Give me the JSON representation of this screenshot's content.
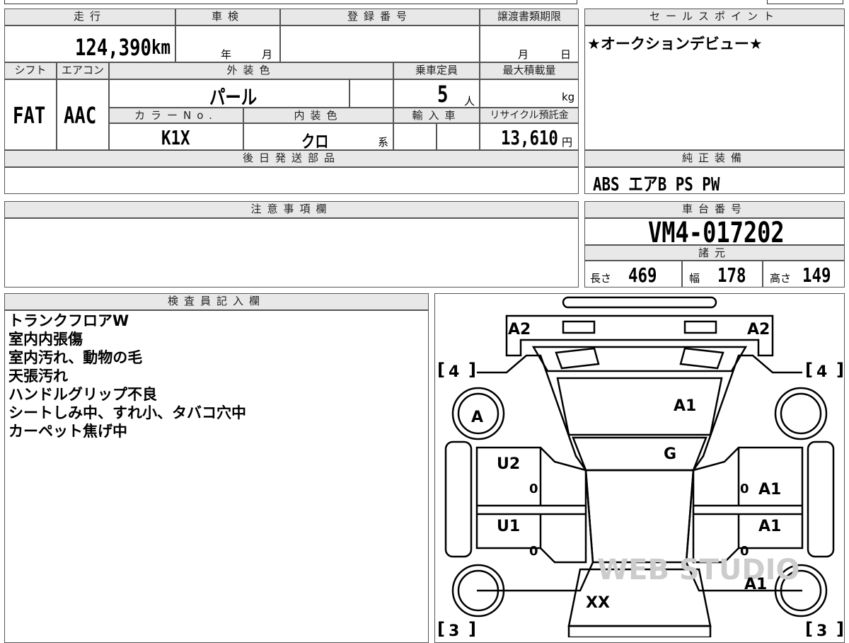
{
  "vehicle": {
    "headers": {
      "mileage": "走行",
      "inspection": "車検",
      "registration": "登録番号",
      "transfer_deadline": "譲渡書類期限",
      "shift": "シフト",
      "aircon": "エアコン",
      "exterior_color": "外装色",
      "capacity": "乗車定員",
      "max_load": "最大積載量",
      "color_no": "カラーNo.",
      "interior_color": "内装色",
      "import": "輸入車",
      "recycle_fee": "リサイクル預託金",
      "later_parts": "後日発送部品"
    },
    "mileage": "124,390",
    "mileage_unit": "km",
    "inspection_year_unit": "年",
    "inspection_month_unit": "月",
    "deadline_month_unit": "月",
    "deadline_day_unit": "日",
    "shift": "FAT",
    "aircon": "AAC",
    "exterior_color": "パール",
    "capacity": "5",
    "capacity_unit": "人",
    "max_load_unit": "kg",
    "color_no": "K1X",
    "interior_color": "クロ",
    "interior_suffix": "系",
    "recycle_fee": "13,610",
    "recycle_unit": "円"
  },
  "sales_point": {
    "header": "セールスポイント",
    "text": "★オークションデビュー★"
  },
  "equipment": {
    "header": "純正装備",
    "text": "ABS エアB PS PW"
  },
  "notes": {
    "header": "注意事項欄"
  },
  "chassis": {
    "header": "車台番号",
    "number": "VM4-017202"
  },
  "specs": {
    "header": "諸元",
    "length_label": "長さ",
    "length": "469",
    "width_label": "幅",
    "width": "178",
    "height_label": "高さ",
    "height": "149"
  },
  "inspector": {
    "header": "検査員記入欄",
    "lines": [
      "トランクフロアW",
      "室内内張傷",
      "室内汚れ、動物の毛",
      "天張汚れ",
      "ハンドルグリップ不良",
      "シートしみ中、すれ小、タバコ穴中",
      "カーペット焦げ中"
    ]
  },
  "diagram": {
    "labels": {
      "rear_left": "A2",
      "rear_right": "A2",
      "tire_rl": "4",
      "tire_rr": "4",
      "tire_fl": "3",
      "tire_fr": "3",
      "wheel_rl": "A",
      "rear_glass": "A1",
      "roof": "G",
      "rear_door_l": "U2",
      "rear_door_r": "A1",
      "front_door_l": "U1",
      "front_door_r": "A1",
      "front_fender_r": "A1",
      "hood": "XX",
      "zero_1": "0",
      "zero_2": "0",
      "zero_3": "0",
      "zero_4": "0"
    },
    "watermark": "WEB STUDIO"
  }
}
